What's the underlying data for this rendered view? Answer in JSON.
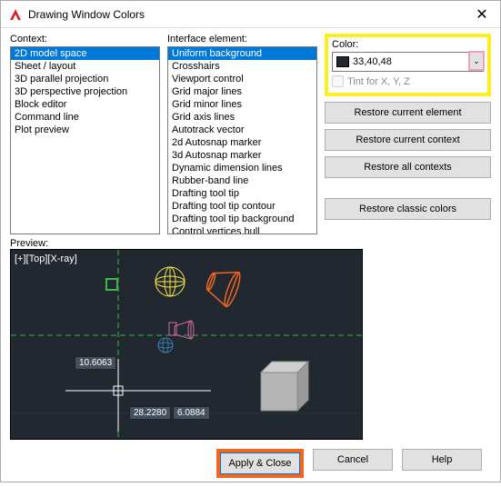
{
  "window": {
    "title": "Drawing Window Colors",
    "close": "✕"
  },
  "labels": {
    "context": "Context:",
    "interface": "Interface element:",
    "color": "Color:",
    "preview": "Preview:"
  },
  "contexts": [
    "2D model space",
    "Sheet / layout",
    "3D parallel projection",
    "3D perspective projection",
    "Block editor",
    "Command line",
    "Plot preview"
  ],
  "interfaceElements": [
    "Uniform background",
    "Crosshairs",
    "Viewport control",
    "Grid major lines",
    "Grid minor lines",
    "Grid axis lines",
    "Autotrack vector",
    "2d Autosnap marker",
    "3d Autosnap marker",
    "Dynamic dimension lines",
    "Rubber-band line",
    "Drafting tool tip",
    "Drafting tool tip contour",
    "Drafting tool tip background",
    "Control vertices hull"
  ],
  "color": {
    "value": "33,40,48",
    "tintLabel": "Tint for X, Y, Z"
  },
  "buttons": {
    "restoreElement": "Restore current element",
    "restoreContext": "Restore current context",
    "restoreAll": "Restore all contexts",
    "restoreClassic": "Restore classic colors",
    "apply": "Apply & Close",
    "cancel": "Cancel",
    "help": "Help"
  },
  "preview": {
    "viewLabel": "[+][Top][X-ray]",
    "tooltip": "10.6063",
    "coord1": "28.2280",
    "coord2": "6.0884"
  }
}
